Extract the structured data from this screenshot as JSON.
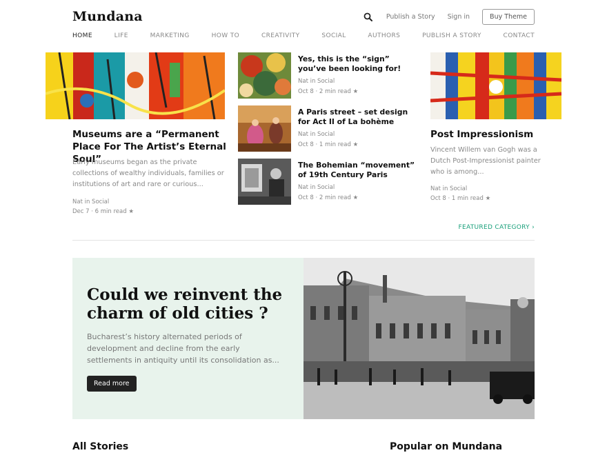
{
  "brand": "Mundana",
  "top": {
    "publish": "Publish a Story",
    "signin": "Sign in",
    "buy": "Buy Theme"
  },
  "nav": [
    "HOME",
    "LIFE",
    "MARKETING",
    "HOW TO",
    "CREATIVITY",
    "SOCIAL",
    "AUTHORS",
    "PUBLISH A STORY",
    "CONTACT"
  ],
  "left_card": {
    "title": "Museums are a “Permanent Place For The Artist’s Eternal Soul”",
    "excerpt": "Early museums began as the private collections of wealthy individuals, families or institutions of art and rare or curious...",
    "author": "Nat in Social",
    "date": "Dec 7 · 6 min read ★"
  },
  "middle_cards": [
    {
      "title": "Yes, this is the “sign” you’ve been looking for!",
      "author": "Nat in Social",
      "date": "Oct 8 · 2 min read ★"
    },
    {
      "title": "A Paris street – set design for Act II of La bohème",
      "author": "Nat in Social",
      "date": "Oct 8 · 1 min read ★"
    },
    {
      "title": "The Bohemian “movement” of 19th Century Paris",
      "author": "Nat in Social",
      "date": "Oct 8 · 2 min read ★"
    }
  ],
  "right_card": {
    "title": "Post Impressionism",
    "excerpt": "Vincent Willem van Gogh was a Dutch Post-Impressionist painter who is among...",
    "author": "Nat in Social",
    "date": "Oct 8 · 1 min read ★"
  },
  "featured_link": "FEATURED CATEGORY ›",
  "hero": {
    "title": "Could we reinvent the charm of old cities ?",
    "text": "Bucharest’s history alternated periods of development and decline from the early settlements in antiquity until its consolidation as...",
    "button": "Read more"
  },
  "sections": {
    "all_stories": "All Stories",
    "popular": "Popular on Mundana"
  },
  "colors": {
    "accent": "#1aa07b",
    "hero_bg": "#e8f3ec",
    "button": "#222222"
  }
}
